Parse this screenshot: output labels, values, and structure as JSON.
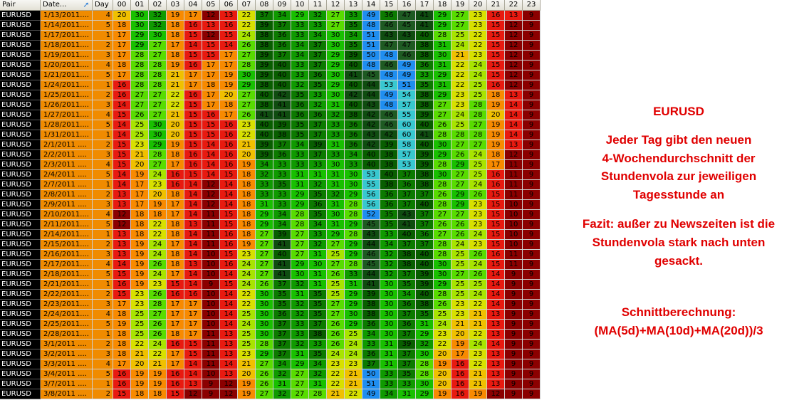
{
  "header": {
    "pair": "Pair",
    "date": "Date...",
    "day": "Day",
    "hours": [
      "00",
      "01",
      "02",
      "03",
      "04",
      "05",
      "06",
      "07",
      "08",
      "09",
      "10",
      "11",
      "12",
      "13",
      "14",
      "15",
      "16",
      "17",
      "18",
      "19",
      "20",
      "21",
      "22",
      "23"
    ]
  },
  "rows": [
    {
      "pair": "EURUSD",
      "date": "1/13/2011....",
      "day": "4",
      "v": [
        20,
        30,
        32,
        19,
        17,
        12,
        13,
        22,
        37,
        34,
        29,
        32,
        27,
        33,
        49,
        36,
        47,
        41,
        29,
        27,
        23,
        16,
        13,
        9
      ]
    },
    {
      "pair": "EURUSD",
      "date": "1/14/2011....",
      "day": "5",
      "v": [
        18,
        30,
        32,
        18,
        16,
        13,
        16,
        22,
        39,
        37,
        33,
        33,
        27,
        35,
        48,
        46,
        45,
        41,
        29,
        27,
        23,
        15,
        12,
        9
      ]
    },
    {
      "pair": "EURUSD",
      "date": "1/17/2011....",
      "day": "1",
      "v": [
        17,
        29,
        30,
        18,
        15,
        12,
        15,
        24,
        38,
        36,
        33,
        34,
        30,
        34,
        51,
        43,
        43,
        40,
        28,
        25,
        22,
        15,
        12,
        9
      ]
    },
    {
      "pair": "EURUSD",
      "date": "1/18/2011....",
      "day": "2",
      "v": [
        17,
        29,
        27,
        17,
        14,
        15,
        14,
        26,
        38,
        36,
        34,
        37,
        30,
        35,
        51,
        47,
        47,
        38,
        31,
        24,
        22,
        15,
        12,
        9
      ]
    },
    {
      "pair": "EURUSD",
      "date": "1/19/2011....",
      "day": "3",
      "v": [
        17,
        28,
        27,
        18,
        15,
        15,
        17,
        27,
        39,
        37,
        34,
        37,
        29,
        39,
        50,
        48,
        46,
        38,
        30,
        21,
        23,
        15,
        12,
        9
      ]
    },
    {
      "pair": "EURUSD",
      "date": "1/20/2011....",
      "day": "4",
      "v": [
        18,
        28,
        28,
        19,
        16,
        17,
        17,
        28,
        39,
        40,
        33,
        37,
        29,
        40,
        48,
        46,
        49,
        36,
        31,
        22,
        24,
        15,
        12,
        9
      ]
    },
    {
      "pair": "EURUSD",
      "date": "1/21/2011....",
      "day": "5",
      "v": [
        17,
        28,
        28,
        21,
        17,
        17,
        19,
        30,
        39,
        40,
        33,
        36,
        30,
        41,
        45,
        48,
        49,
        33,
        29,
        22,
        24,
        15,
        12,
        9
      ]
    },
    {
      "pair": "EURUSD",
      "date": "1/24/2011....",
      "day": "1",
      "v": [
        16,
        28,
        28,
        21,
        17,
        18,
        19,
        29,
        38,
        40,
        32,
        35,
        29,
        40,
        44,
        53,
        51,
        35,
        31,
        22,
        25,
        16,
        12,
        9
      ]
    },
    {
      "pair": "EURUSD",
      "date": "1/25/2011....",
      "day": "2",
      "v": [
        16,
        27,
        27,
        22,
        16,
        17,
        20,
        27,
        40,
        42,
        35,
        33,
        30,
        42,
        44,
        49,
        54,
        38,
        29,
        23,
        25,
        18,
        13,
        9
      ]
    },
    {
      "pair": "EURUSD",
      "date": "1/26/2011....",
      "day": "3",
      "v": [
        14,
        27,
        27,
        22,
        15,
        17,
        18,
        27,
        38,
        41,
        36,
        32,
        31,
        40,
        43,
        48,
        57,
        38,
        27,
        23,
        28,
        19,
        14,
        9
      ]
    },
    {
      "pair": "EURUSD",
      "date": "1/27/2011....",
      "day": "4",
      "v": [
        15,
        26,
        27,
        21,
        15,
        16,
        17,
        26,
        41,
        41,
        36,
        36,
        32,
        38,
        42,
        46,
        55,
        39,
        27,
        24,
        28,
        20,
        14,
        9
      ]
    },
    {
      "pair": "EURUSD",
      "date": "1/28/2011....",
      "day": "5",
      "v": [
        14,
        25,
        30,
        20,
        15,
        15,
        16,
        23,
        40,
        39,
        35,
        37,
        33,
        36,
        42,
        46,
        60,
        40,
        26,
        25,
        27,
        19,
        14,
        9
      ]
    },
    {
      "pair": "EURUSD",
      "date": "1/31/2011....",
      "day": "1",
      "v": [
        14,
        25,
        30,
        20,
        15,
        15,
        16,
        22,
        40,
        38,
        35,
        37,
        33,
        36,
        43,
        42,
        60,
        41,
        28,
        28,
        28,
        19,
        14,
        9
      ]
    },
    {
      "pair": "EURUSD",
      "date": "2/1/2011 ....",
      "day": "2",
      "v": [
        15,
        23,
        29,
        19,
        15,
        14,
        16,
        21,
        39,
        37,
        34,
        39,
        31,
        36,
        42,
        39,
        58,
        40,
        30,
        27,
        27,
        19,
        13,
        9
      ]
    },
    {
      "pair": "EURUSD",
      "date": "2/2/2011 ....",
      "day": "3",
      "v": [
        15,
        21,
        28,
        18,
        16,
        14,
        16,
        20,
        39,
        36,
        33,
        37,
        33,
        34,
        40,
        38,
        57,
        39,
        29,
        26,
        24,
        18,
        12,
        9
      ]
    },
    {
      "pair": "EURUSD",
      "date": "2/3/2011 ....",
      "day": "4",
      "v": [
        15,
        20,
        27,
        17,
        16,
        14,
        16,
        19,
        34,
        33,
        33,
        33,
        30,
        33,
        40,
        38,
        53,
        39,
        28,
        29,
        25,
        17,
        11,
        9
      ]
    },
    {
      "pair": "EURUSD",
      "date": "2/4/2011 ....",
      "day": "5",
      "v": [
        14,
        19,
        24,
        16,
        15,
        14,
        15,
        18,
        32,
        33,
        31,
        31,
        31,
        30,
        53,
        40,
        37,
        38,
        30,
        27,
        25,
        16,
        11,
        9
      ]
    },
    {
      "pair": "EURUSD",
      "date": "2/7/2011 ....",
      "day": "1",
      "v": [
        14,
        17,
        23,
        16,
        14,
        12,
        14,
        18,
        33,
        35,
        31,
        32,
        31,
        30,
        55,
        38,
        36,
        38,
        28,
        27,
        24,
        16,
        11,
        9
      ]
    },
    {
      "pair": "EURUSD",
      "date": "2/8/2011 ....",
      "day": "2",
      "v": [
        13,
        17,
        20,
        18,
        14,
        12,
        14,
        18,
        33,
        33,
        29,
        35,
        32,
        29,
        56,
        36,
        37,
        37,
        26,
        29,
        26,
        15,
        11,
        9
      ]
    },
    {
      "pair": "EURUSD",
      "date": "2/9/2011 ....",
      "day": "3",
      "v": [
        13,
        17,
        19,
        17,
        14,
        12,
        14,
        18,
        31,
        33,
        29,
        36,
        31,
        28,
        56,
        36,
        37,
        40,
        28,
        29,
        23,
        15,
        10,
        9
      ]
    },
    {
      "pair": "EURUSD",
      "date": "2/10/2011....",
      "day": "4",
      "v": [
        12,
        18,
        18,
        17,
        14,
        11,
        15,
        18,
        29,
        34,
        28,
        35,
        30,
        28,
        52,
        35,
        43,
        37,
        27,
        27,
        23,
        15,
        10,
        9
      ]
    },
    {
      "pair": "EURUSD",
      "date": "2/11/2011....",
      "day": "5",
      "v": [
        12,
        18,
        22,
        18,
        13,
        11,
        15,
        18,
        29,
        34,
        28,
        34,
        31,
        29,
        45,
        35,
        41,
        37,
        26,
        26,
        23,
        15,
        10,
        9
      ]
    },
    {
      "pair": "EURUSD",
      "date": "2/14/2011....",
      "day": "1",
      "v": [
        13,
        18,
        22,
        18,
        14,
        11,
        16,
        18,
        27,
        39,
        27,
        33,
        29,
        28,
        43,
        33,
        40,
        36,
        27,
        26,
        24,
        15,
        10,
        9
      ]
    },
    {
      "pair": "EURUSD",
      "date": "2/15/2011....",
      "day": "2",
      "v": [
        13,
        19,
        24,
        17,
        14,
        11,
        16,
        19,
        27,
        41,
        27,
        32,
        27,
        29,
        44,
        34,
        37,
        37,
        28,
        24,
        23,
        15,
        10,
        9
      ]
    },
    {
      "pair": "EURUSD",
      "date": "2/16/2011....",
      "day": "3",
      "v": [
        13,
        19,
        24,
        18,
        14,
        10,
        15,
        23,
        27,
        40,
        27,
        31,
        25,
        29,
        46,
        32,
        38,
        40,
        28,
        25,
        26,
        16,
        11,
        9
      ]
    },
    {
      "pair": "EURUSD",
      "date": "2/17/2011....",
      "day": "4",
      "v": [
        14,
        19,
        26,
        18,
        13,
        10,
        16,
        24,
        27,
        41,
        29,
        30,
        27,
        28,
        45,
        32,
        38,
        40,
        30,
        25,
        24,
        15,
        11,
        9
      ]
    },
    {
      "pair": "EURUSD",
      "date": "2/18/2011....",
      "day": "5",
      "v": [
        15,
        19,
        24,
        17,
        14,
        10,
        14,
        24,
        27,
        41,
        30,
        31,
        26,
        33,
        44,
        32,
        37,
        39,
        30,
        27,
        26,
        14,
        9,
        9
      ]
    },
    {
      "pair": "EURUSD",
      "date": "2/21/2011....",
      "day": "1",
      "v": [
        16,
        19,
        23,
        15,
        14,
        9,
        15,
        24,
        26,
        37,
        32,
        31,
        25,
        31,
        41,
        30,
        35,
        39,
        29,
        25,
        25,
        14,
        9,
        9
      ]
    },
    {
      "pair": "EURUSD",
      "date": "2/22/2011....",
      "day": "2",
      "v": [
        15,
        23,
        26,
        16,
        16,
        10,
        14,
        22,
        30,
        35,
        31,
        35,
        25,
        29,
        39,
        30,
        34,
        40,
        28,
        25,
        24,
        14,
        9,
        9
      ]
    },
    {
      "pair": "EURUSD",
      "date": "2/23/2011....",
      "day": "3",
      "v": [
        17,
        23,
        28,
        17,
        17,
        10,
        14,
        22,
        30,
        35,
        32,
        35,
        27,
        29,
        38,
        30,
        36,
        38,
        26,
        23,
        22,
        14,
        9,
        9
      ]
    },
    {
      "pair": "EURUSD",
      "date": "2/24/2011....",
      "day": "4",
      "v": [
        18,
        25,
        27,
        17,
        17,
        10,
        14,
        25,
        30,
        36,
        32,
        35,
        27,
        30,
        38,
        30,
        37,
        35,
        25,
        23,
        21,
        13,
        9,
        9
      ]
    },
    {
      "pair": "EURUSD",
      "date": "2/25/2011....",
      "day": "5",
      "v": [
        19,
        25,
        26,
        17,
        17,
        10,
        14,
        24,
        30,
        37,
        33,
        37,
        26,
        29,
        36,
        30,
        36,
        31,
        24,
        21,
        21,
        13,
        9,
        9
      ]
    },
    {
      "pair": "EURUSD",
      "date": "2/28/2011....",
      "day": "1",
      "v": [
        18,
        25,
        26,
        18,
        17,
        11,
        13,
        25,
        30,
        37,
        33,
        38,
        26,
        25,
        34,
        30,
        37,
        29,
        23,
        20,
        22,
        13,
        9,
        9
      ]
    },
    {
      "pair": "EURUSD",
      "date": "3/1/2011 ....",
      "day": "2",
      "v": [
        18,
        22,
        24,
        16,
        15,
        11,
        13,
        25,
        28,
        37,
        32,
        33,
        26,
        24,
        33,
        31,
        39,
        32,
        22,
        19,
        24,
        14,
        9,
        9
      ]
    },
    {
      "pair": "EURUSD",
      "date": "3/2/2011 ....",
      "day": "3",
      "v": [
        18,
        21,
        22,
        17,
        15,
        11,
        13,
        23,
        29,
        37,
        31,
        35,
        24,
        24,
        36,
        31,
        37,
        30,
        20,
        17,
        23,
        13,
        9,
        9
      ]
    },
    {
      "pair": "EURUSD",
      "date": "3/3/2011 ....",
      "day": "4",
      "v": [
        17,
        20,
        21,
        17,
        14,
        11,
        14,
        21,
        27,
        34,
        29,
        34,
        23,
        23,
        37,
        31,
        37,
        28,
        19,
        16,
        22,
        13,
        9,
        9
      ]
    },
    {
      "pair": "EURUSD",
      "date": "3/4/2011 ....",
      "day": "5",
      "v": [
        16,
        19,
        19,
        16,
        14,
        10,
        13,
        20,
        26,
        32,
        27,
        32,
        22,
        21,
        50,
        33,
        35,
        28,
        20,
        16,
        21,
        13,
        9,
        9
      ]
    },
    {
      "pair": "EURUSD",
      "date": "3/7/2011 ....",
      "day": "1",
      "v": [
        16,
        19,
        19,
        16,
        13,
        9,
        12,
        19,
        26,
        31,
        27,
        31,
        22,
        21,
        51,
        33,
        33,
        30,
        20,
        16,
        21,
        13,
        9,
        9
      ]
    },
    {
      "pair": "EURUSD",
      "date": "3/8/2011 ....",
      "day": "2",
      "v": [
        15,
        18,
        18,
        15,
        12,
        9,
        12,
        19,
        27,
        32,
        27,
        28,
        21,
        22,
        49,
        34,
        31,
        29,
        19,
        16,
        19,
        12,
        9,
        9
      ]
    }
  ],
  "notes": {
    "title": "EURUSD",
    "line1": "Jeder Tag gibt den neuen",
    "line2": "4-Wochendurchschnitt der",
    "line3": "Stundenvola zur jeweiligen",
    "line4": "Tagesstunde an",
    "fazit1": "Fazit: außer zu Newszeiten ist die",
    "fazit2": "Stundenvola stark nach unten",
    "fazit3": "gesackt.",
    "calc1": "Schnittberechnung:",
    "calc2": "(MA(5d)+MA(10d)+MA(20d))/3"
  },
  "colors": {
    "text_red": "#e00000",
    "pair_bg": "#000000",
    "date_bg": "#f08b00"
  }
}
